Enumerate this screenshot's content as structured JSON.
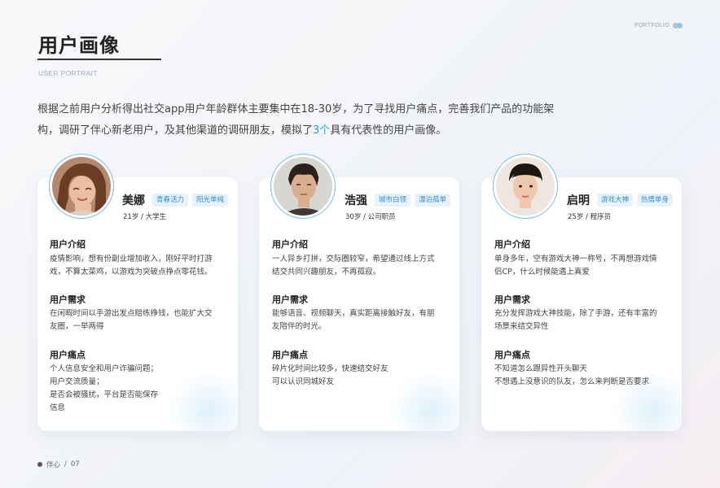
{
  "brand": {
    "text": "PORTFOLIO"
  },
  "header": {
    "title": "用户画像",
    "subtitle": "USER PORTRAIT"
  },
  "intro": {
    "part1": "根据之前用户分析得出社交app用户年龄群体主要集中在18-30岁，为了寻找用户痛点，完善我们产品的功能架",
    "part2": "构，调研了伴心新老用户，及其他渠道的调研朋友，模拟了",
    "highlight": "3个",
    "part3": "具有代表性的用户画像。"
  },
  "labels": {
    "intro": "用户介绍",
    "needs": "用户需求",
    "pains": "用户痛点"
  },
  "personas": [
    {
      "name": "美娜",
      "tags": [
        "青春活力",
        "阳光单纯"
      ],
      "meta": "21岁 / 大学生",
      "intro": [
        "疫情影响，想有份副业增加收入，刚好平时打游",
        "戏，不算太菜鸡，以游戏为突破点挣点零花钱。"
      ],
      "needs": [
        "在闲暇时间以手游出发点赔练挣钱，也能扩大交",
        "友圈，一举两得"
      ],
      "pains": [
        "个人信息安全和用户诈骗问题；",
        "用户交流质量；",
        "是否会被骚扰，平台是否能保存",
        "信息"
      ]
    },
    {
      "name": "浩强",
      "tags": [
        "城市白领",
        "漂泊孤单"
      ],
      "meta": "30岁 / 公司职员",
      "intro": [
        "一人异乡打拼，交际圈较窄，希望通过线上方式",
        "结交共同兴趣朋友，不再孤寂。"
      ],
      "needs": [
        "能够语音、视频聊天，真实距离接触好友，有朋",
        "友陪伴的时光。"
      ],
      "pains": [
        "碎片化时间比较多，快速结交好友",
        "可以认识同城好友"
      ]
    },
    {
      "name": "启明",
      "tags": [
        "游戏大神",
        "热情单身"
      ],
      "meta": "25岁 / 程序员",
      "intro": [
        "单身多年，空有游戏大神一称号，不再想游戏情",
        "侣CP，什么时候能遇上真爱"
      ],
      "needs": [
        "充分发挥游戏大神技能，除了手游，还有丰富的",
        "场景来结交异性"
      ],
      "pains": [
        "不知道怎么跟异性开头聊天",
        "不想遇上没意识的队友，怎么来判断是否要求"
      ]
    }
  ],
  "footer": {
    "brand": "伴心",
    "separator": "/",
    "page": "07"
  },
  "colors": {
    "accent": "#23a5d8",
    "tag_text": "#2e8fd0",
    "tag_bg": "#e7f2fb",
    "avatar_ring": "#79bde6"
  }
}
